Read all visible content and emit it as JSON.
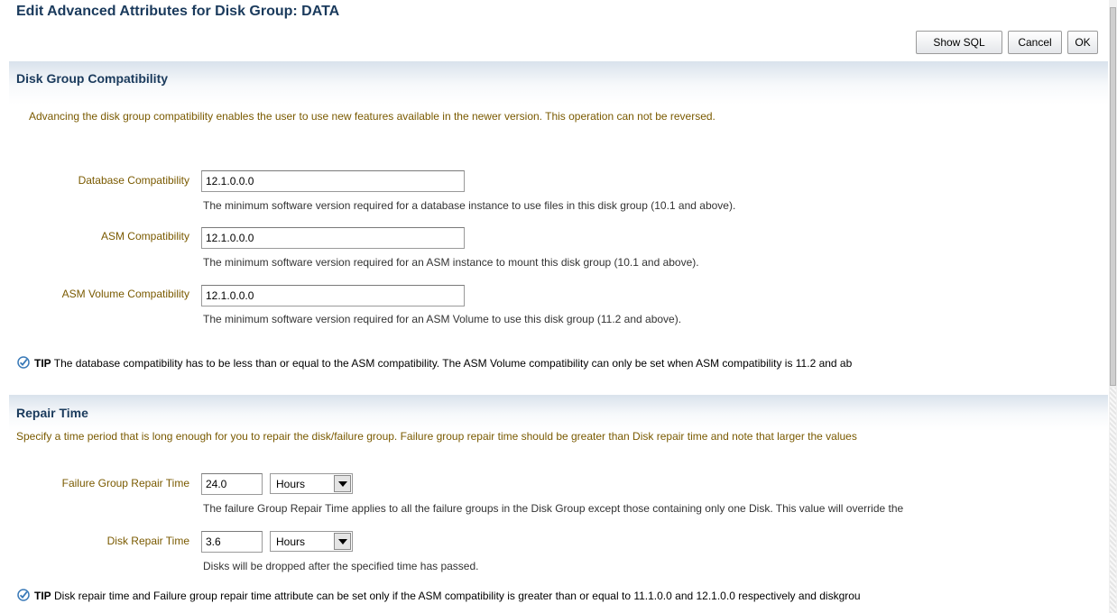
{
  "page": {
    "title": "Edit Advanced Attributes for Disk Group: DATA"
  },
  "toolbar": {
    "show_sql_label": "Show SQL",
    "cancel_label": "Cancel",
    "ok_label": "OK"
  },
  "compatibility": {
    "header": "Disk Group Compatibility",
    "description": "Advancing the disk group compatibility enables the user to use new features available in the newer version. This operation can not be reversed.",
    "fields": [
      {
        "label": "Database Compatibility",
        "value": "12.1.0.0.0",
        "help": "The minimum software version required for a database instance to use files in this disk group (10.1 and above)."
      },
      {
        "label": "ASM Compatibility",
        "value": "12.1.0.0.0",
        "help": "The minimum software version required for an ASM instance to mount this disk group (10.1 and above)."
      },
      {
        "label": "ASM Volume Compatibility",
        "value": "12.1.0.0.0",
        "help": "The minimum software version required for an ASM Volume to use this disk group (11.2 and above)."
      }
    ],
    "tip_label": "TIP",
    "tip_text": "The database compatibility has to be less than or equal to the ASM compatibility. The ASM Volume compatibility can only be set when ASM compatibility is 11.2 and ab",
    "tip_icon": "check-circle-icon"
  },
  "repair": {
    "header": "Repair Time",
    "description": "Specify a time period that is long enough for you to repair the disk/failure group. Failure group repair time should be greater than Disk repair time and note that larger the values",
    "fields": [
      {
        "label": "Failure Group Repair Time",
        "value": "24.0",
        "unit": "Hours",
        "help": "The failure Group Repair Time applies to all the failure groups in the Disk Group except those containing only one Disk. This value will override the"
      },
      {
        "label": "Disk Repair Time",
        "value": "3.6",
        "unit": "Hours",
        "help": "Disks will be dropped after the specified time has passed."
      }
    ],
    "tip_label": "TIP",
    "tip_text": "Disk repair time and Failure group repair time attribute can be set only if the ASM compatibility is greater than or equal to 11.1.0.0 and 12.1.0.0 respectively and diskgrou",
    "tip_icon": "check-circle-icon"
  },
  "colors": {
    "title": "#1a3a5c",
    "description": "#7a5a00",
    "tip_icon": "#3a7ab8"
  }
}
